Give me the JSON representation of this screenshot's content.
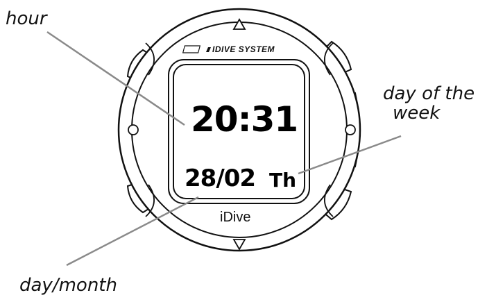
{
  "labels": {
    "hour": "hour",
    "day_of_week_line1": "day of the",
    "day_of_week_line2": "week",
    "day_month": "day/month"
  },
  "display": {
    "time": "20:31",
    "date": "28/02",
    "weekday": "Th"
  },
  "device": {
    "logo_text": "IDIVE SYSTEM",
    "model": "iDive"
  },
  "colors": {
    "line": "#111111",
    "leader": "#8a8a8a",
    "background": "#ffffff"
  }
}
